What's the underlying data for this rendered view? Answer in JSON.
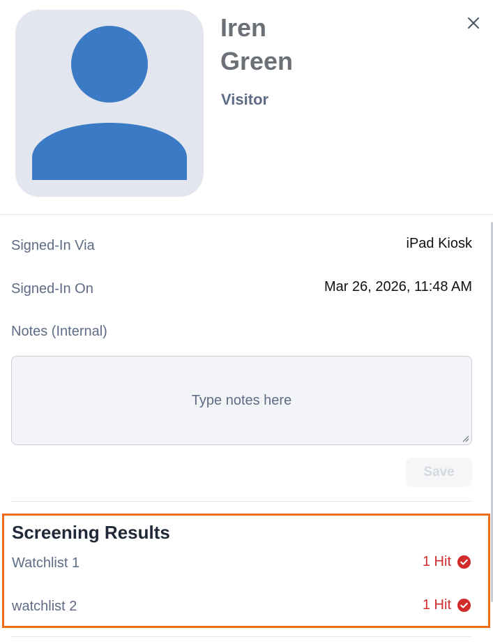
{
  "header": {
    "first_name": "Iren",
    "last_name": "Green",
    "type": "Visitor",
    "avatar_icon": "person-silhouette-icon",
    "close_icon": "close-icon"
  },
  "details": {
    "signed_in_via_label": "Signed-In Via",
    "signed_in_via_value": "iPad Kiosk",
    "signed_in_on_label": "Signed-In On",
    "signed_in_on_value": "Mar 26, 2026, 11:48 AM",
    "notes_label": "Notes (Internal)",
    "notes_placeholder": "Type notes here",
    "notes_value": "",
    "save_label": "Save"
  },
  "screening": {
    "title": "Screening Results",
    "rows": [
      {
        "name": "Watchlist 1",
        "result": "1 Hit",
        "icon": "check-circle-icon"
      },
      {
        "name": "watchlist 2",
        "result": "1 Hit",
        "icon": "check-circle-icon"
      }
    ]
  },
  "colors": {
    "avatar_bg": "#e3e6ee",
    "avatar_fg": "#3b7bc5",
    "label": "#5d6b85",
    "hit_red": "#d12b2b",
    "highlight_orange": "#ee6a1c"
  }
}
